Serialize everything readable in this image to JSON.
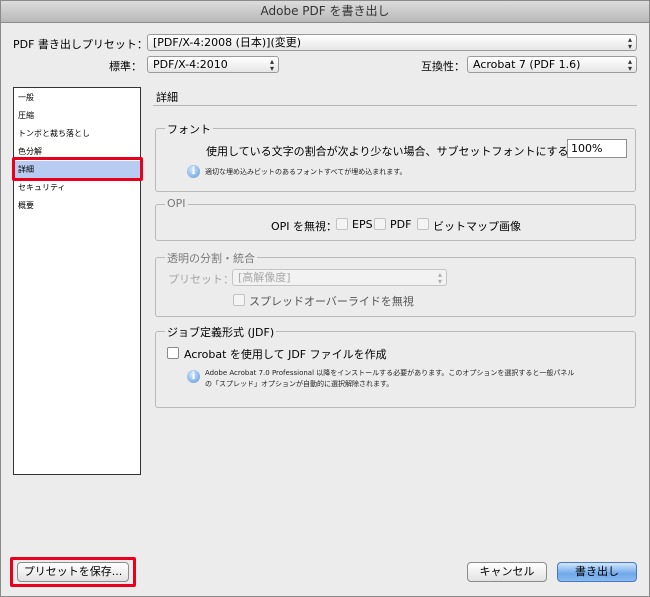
{
  "window": {
    "title": "Adobe PDF を書き出し"
  },
  "top": {
    "preset_label": "PDF 書き出しプリセット：",
    "preset_value": "[PDF/X-4:2008 (日本)](変更)",
    "standard_label": "標準：",
    "standard_value": "PDF/X-4:2010",
    "compat_label": "互換性：",
    "compat_value": "Acrobat 7 (PDF 1.6)"
  },
  "sidebar": {
    "items": [
      {
        "label": "一般"
      },
      {
        "label": "圧縮"
      },
      {
        "label": "トンボと裁ち落とし"
      },
      {
        "label": "色分解"
      },
      {
        "label": "詳細"
      },
      {
        "label": "セキュリティ"
      },
      {
        "label": "概要"
      }
    ],
    "selected_index": 4
  },
  "panel": {
    "title": "詳細",
    "fonts": {
      "title": "フォント",
      "subset_label": "使用している文字の割合が次より少ない場合、サブセットフォントにする：",
      "subset_value": "100%",
      "note": "適切な埋め込みビットのあるフォントすべてが埋め込まれます。"
    },
    "opi": {
      "title": "OPI",
      "omit_label": "OPI を無視：",
      "options": [
        {
          "label": "EPS"
        },
        {
          "label": "PDF"
        },
        {
          "label": "ビットマップ画像"
        }
      ]
    },
    "transparency": {
      "title": "透明の分割・統合",
      "preset_label": "プリセット：",
      "preset_value": "[高解像度]",
      "ignore_spread_label": "スプレッドオーバーライドを無視"
    },
    "jdf": {
      "title": "ジョブ定義形式 (JDF)",
      "checkbox_label": "Acrobat を使用して JDF ファイルを作成",
      "note_line1": "Adobe Acrobat 7.0 Professional 以降をインストールする必要があります。このオプションを選択すると一般パネル",
      "note_line2": "の「スプレッド」オプションが自動的に選択解除されます。"
    }
  },
  "buttons": {
    "save_preset": "プリセットを保存...",
    "cancel": "キャンセル",
    "export": "書き出し"
  },
  "colors": {
    "highlight_box": "#e8001c",
    "selection": "#b7ccf0",
    "default_button": "#6fa8ea"
  }
}
